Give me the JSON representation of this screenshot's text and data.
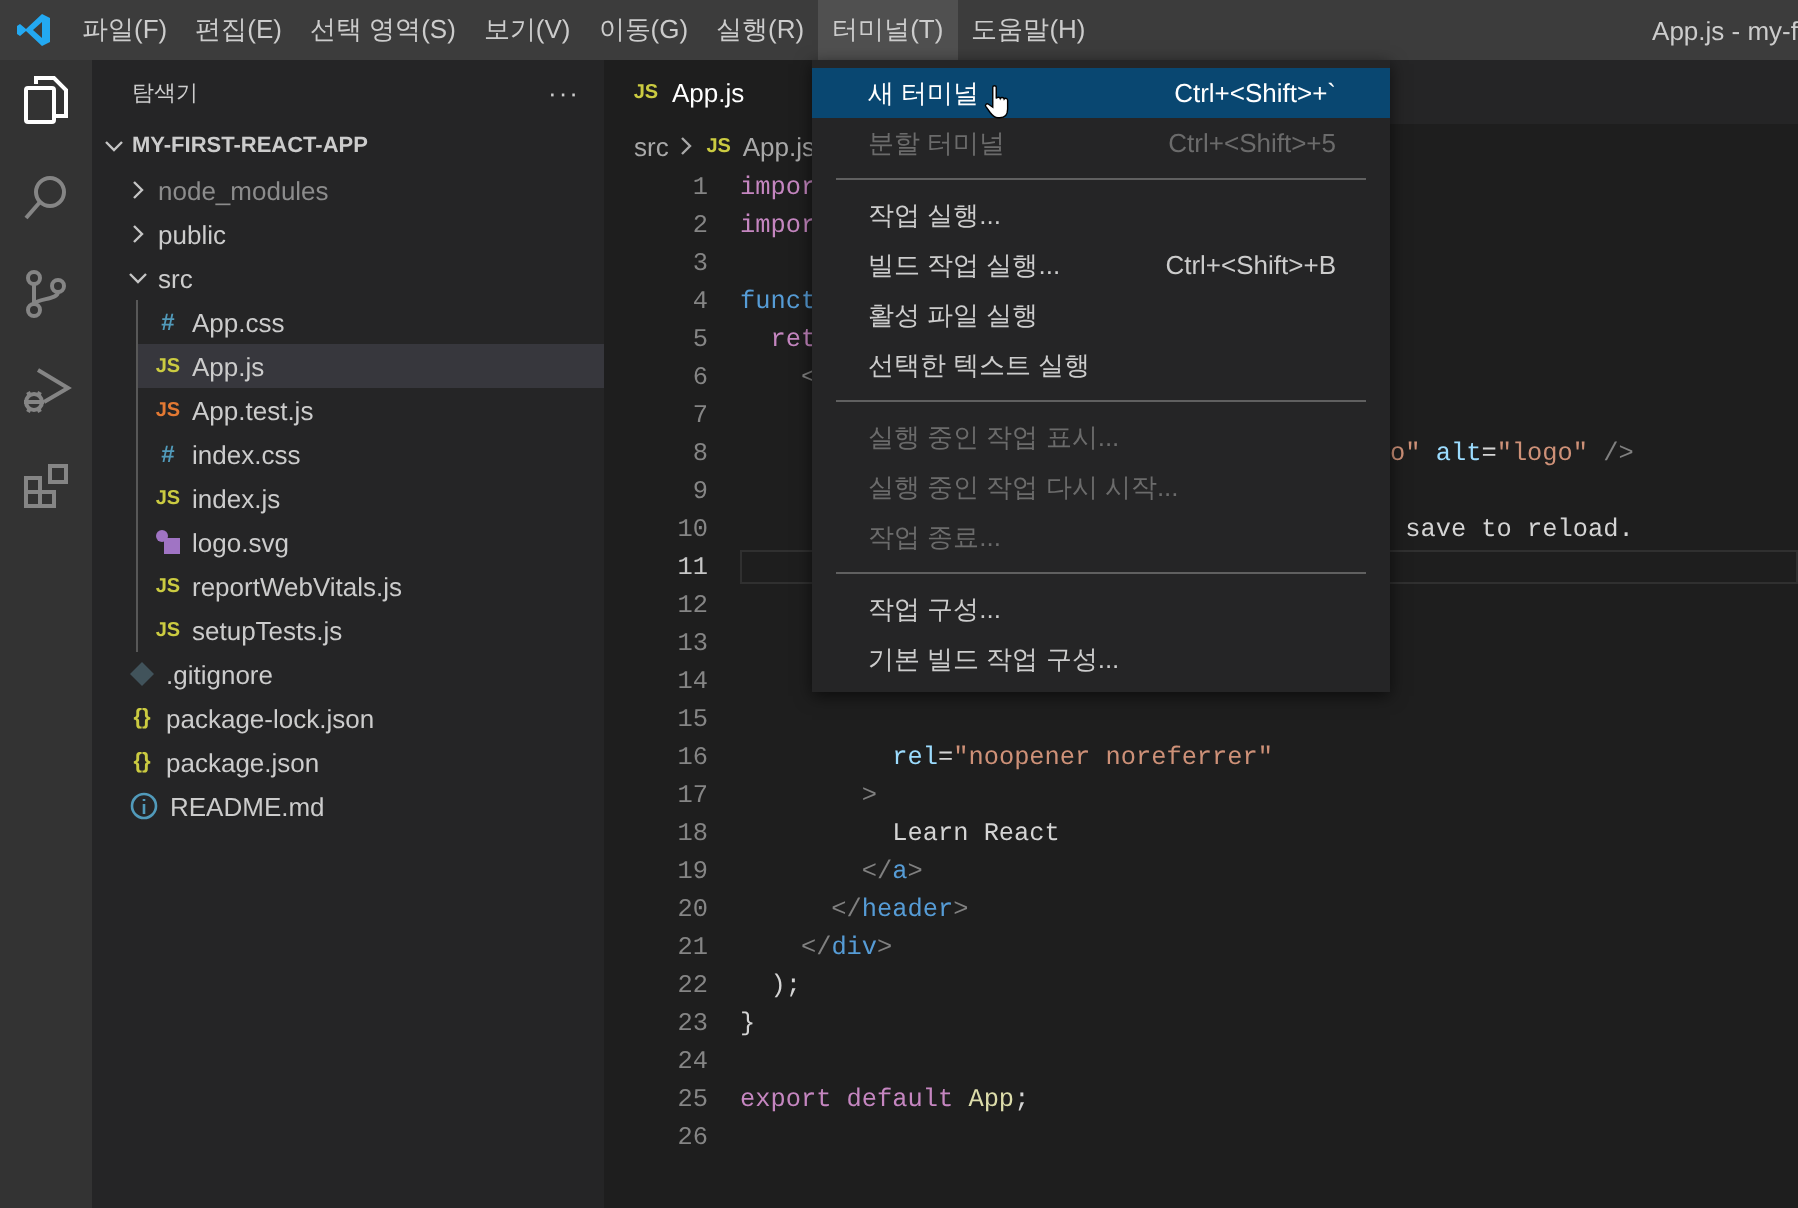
{
  "menubar": {
    "items": [
      {
        "label": "파일(F)",
        "selected": false
      },
      {
        "label": "편집(E)",
        "selected": false
      },
      {
        "label": "선택 영역(S)",
        "selected": false
      },
      {
        "label": "보기(V)",
        "selected": false
      },
      {
        "label": "이동(G)",
        "selected": false
      },
      {
        "label": "실행(R)",
        "selected": false
      },
      {
        "label": "터미널(T)",
        "selected": true
      },
      {
        "label": "도움말(H)",
        "selected": false
      }
    ]
  },
  "window": {
    "title": "App.js - my-f"
  },
  "activity_bar": [
    {
      "kind": "files",
      "selected": true
    },
    {
      "kind": "search",
      "selected": false
    },
    {
      "kind": "source-control",
      "selected": false
    },
    {
      "kind": "debug",
      "selected": false
    },
    {
      "kind": "extensions",
      "selected": false
    }
  ],
  "sidebar": {
    "title": "탐색기",
    "more": "···",
    "project": "MY-FIRST-REACT-APP",
    "expanded": true,
    "items": [
      {
        "name": "node_modules",
        "kind": "folder",
        "expanded": false,
        "selected": false,
        "dimmed": true
      },
      {
        "name": "public",
        "kind": "folder",
        "expanded": false,
        "selected": false,
        "dimmed": false
      },
      {
        "name": "src",
        "kind": "folder",
        "expanded": true,
        "selected": false,
        "dimmed": false,
        "children": [
          {
            "name": "App.css",
            "kind": "css",
            "icon_text": "#",
            "selected": false
          },
          {
            "name": "App.js",
            "kind": "js",
            "icon_text": "JS",
            "selected": true
          },
          {
            "name": "App.test.js",
            "kind": "test",
            "icon_text": "JS",
            "selected": false
          },
          {
            "name": "index.css",
            "kind": "css",
            "icon_text": "#",
            "selected": false
          },
          {
            "name": "index.js",
            "kind": "js",
            "icon_text": "JS",
            "selected": false
          },
          {
            "name": "logo.svg",
            "kind": "svg",
            "selected": false
          },
          {
            "name": "reportWebVitals.js",
            "kind": "js",
            "icon_text": "JS",
            "selected": false
          },
          {
            "name": "setupTests.js",
            "kind": "js",
            "icon_text": "JS",
            "selected": false
          }
        ]
      },
      {
        "name": ".gitignore",
        "kind": "git",
        "selected": false
      },
      {
        "name": "package-lock.json",
        "kind": "json",
        "icon_text": "{}",
        "selected": false
      },
      {
        "name": "package.json",
        "kind": "json",
        "icon_text": "{}",
        "selected": false
      },
      {
        "name": "README.md",
        "kind": "info",
        "selected": false
      }
    ]
  },
  "tabs": [
    {
      "label": "App.js",
      "icon_text": "JS",
      "selected": true
    }
  ],
  "breadcrumb": {
    "folder": "src",
    "icon_text": "JS",
    "file": "App.js"
  },
  "editor": {
    "lines": [
      {
        "number": "1",
        "left": [
          {
            "text": "impor",
            "kind": "keyword"
          }
        ]
      },
      {
        "number": "2",
        "left": [
          {
            "text": "impor",
            "kind": "keyword"
          }
        ]
      },
      {
        "number": "3"
      },
      {
        "number": "4",
        "left": [
          {
            "text": "funct",
            "kind": "storage"
          }
        ]
      },
      {
        "number": "5",
        "left": [
          {
            "text": "  ret",
            "kind": "keyword"
          }
        ]
      },
      {
        "number": "6",
        "left": [
          {
            "text": "    <",
            "kind": "punct"
          }
        ]
      },
      {
        "number": "7"
      },
      {
        "number": "8",
        "right": [
          {
            "text": "o\"",
            "kind": "string"
          },
          {
            "text": " alt",
            "kind": "attr"
          },
          {
            "text": "=",
            "kind": "plain"
          },
          {
            "text": "\"logo\"",
            "kind": "string"
          },
          {
            "text": " />",
            "kind": "punct"
          }
        ]
      },
      {
        "number": "9"
      },
      {
        "number": "10",
        "right": [
          {
            "text": " save to reload.",
            "kind": "plain"
          }
        ]
      },
      {
        "number": "11",
        "current": true
      },
      {
        "number": "12"
      },
      {
        "number": "13"
      },
      {
        "number": "14"
      },
      {
        "number": "15"
      },
      {
        "number": "16",
        "left": [
          {
            "text": "          rel",
            "kind": "attr"
          },
          {
            "text": "=",
            "kind": "plain"
          },
          {
            "text": "\"noopener noreferrer\"",
            "kind": "string"
          }
        ]
      },
      {
        "number": "17",
        "left": [
          {
            "text": "        >",
            "kind": "punct"
          }
        ]
      },
      {
        "number": "18",
        "left": [
          {
            "text": "          Learn React",
            "kind": "plain"
          }
        ]
      },
      {
        "number": "19",
        "left": [
          {
            "text": "        </",
            "kind": "punct"
          },
          {
            "text": "a",
            "kind": "storage"
          },
          {
            "text": ">",
            "kind": "punct"
          }
        ]
      },
      {
        "number": "20",
        "left": [
          {
            "text": "      </",
            "kind": "punct"
          },
          {
            "text": "header",
            "kind": "storage"
          },
          {
            "text": ">",
            "kind": "punct"
          }
        ]
      },
      {
        "number": "21",
        "left": [
          {
            "text": "    </",
            "kind": "punct"
          },
          {
            "text": "div",
            "kind": "storage"
          },
          {
            "text": ">",
            "kind": "punct"
          }
        ]
      },
      {
        "number": "22",
        "left": [
          {
            "text": "  );",
            "kind": "plain"
          }
        ]
      },
      {
        "number": "23",
        "left": [
          {
            "text": "}",
            "kind": "plain"
          }
        ]
      },
      {
        "number": "24"
      },
      {
        "number": "25",
        "left": [
          {
            "text": "export default",
            "kind": "keyword"
          },
          {
            "text": " App",
            "kind": "function"
          },
          {
            "text": ";",
            "kind": "plain"
          }
        ]
      },
      {
        "number": "26"
      }
    ]
  },
  "menu": {
    "groups": [
      [
        {
          "label": "새 터미널",
          "shortcut": "Ctrl+<Shift>+`",
          "disabled": false,
          "selected": true
        },
        {
          "label": "분할 터미널",
          "shortcut": "Ctrl+<Shift>+5",
          "disabled": true,
          "selected": false
        }
      ],
      [
        {
          "label": "작업 실행...",
          "disabled": false,
          "selected": false
        },
        {
          "label": "빌드 작업 실행...",
          "shortcut": "Ctrl+<Shift>+B",
          "disabled": false,
          "selected": false
        },
        {
          "label": "활성 파일 실행",
          "disabled": false,
          "selected": false
        },
        {
          "label": "선택한 텍스트 실행",
          "disabled": false,
          "selected": false
        }
      ],
      [
        {
          "label": "실행 중인 작업 표시...",
          "disabled": true,
          "selected": false
        },
        {
          "label": "실행 중인 작업 다시 시작...",
          "disabled": true,
          "selected": false
        },
        {
          "label": "작업 종료...",
          "disabled": true,
          "selected": false
        }
      ],
      [
        {
          "label": "작업 구성...",
          "disabled": false,
          "selected": false
        },
        {
          "label": "기본 빌드 작업 구성...",
          "disabled": false,
          "selected": false
        }
      ]
    ]
  }
}
